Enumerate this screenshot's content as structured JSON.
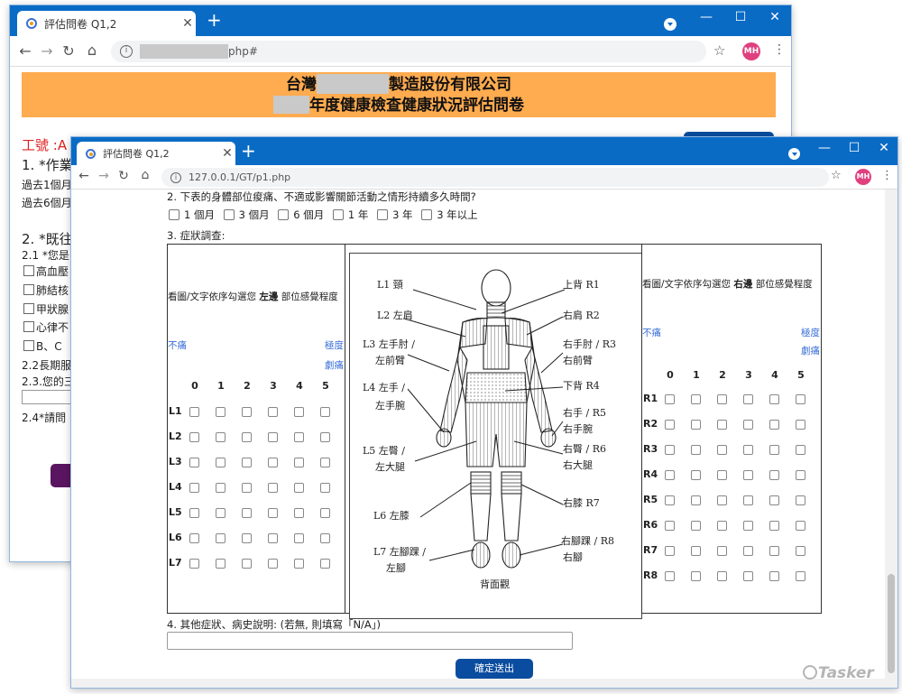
{
  "back_window": {
    "tab_title": "評估問卷 Q1,2",
    "url_suffix": "php#",
    "avatar": "MH",
    "banner_line1_pre": "台灣",
    "banner_line1_post": "製造股份有限公司",
    "banner_line2_post": "年度健康檢查健康狀況評估問卷",
    "employee_label": "工號 :A",
    "q1": "1. *作業",
    "past1": "過去1個月",
    "past6": "過去6個月",
    "q2": "2. *既往",
    "q21": "2.1 *您是",
    "items": [
      "高血壓",
      "肺結核",
      "甲狀腺",
      "心律不",
      "B、C"
    ],
    "q22": "2.2長期服",
    "q23": "2.3.您的三",
    "q24": "2.4*請問"
  },
  "front_window": {
    "tab_title": "評估問卷 Q1,2",
    "url": "127.0.0.1/GT/p1.php",
    "avatar": "MH",
    "q2_text": "2. 下表的身體部位痠痛、不適或影響關節活動之情形持續多久時間?",
    "durations": [
      "1 個月",
      "3 個月",
      "6 個月",
      "1 年",
      "3 年",
      "3 年以上"
    ],
    "q3_text": "3. 症狀調查:",
    "left_panel": {
      "title_pre": "看圖/文字依序勾選您 ",
      "title_bold": "左邊",
      "title_post": " 部位感覺程度",
      "min_label": "不痛",
      "max_label_1": "極度",
      "max_label_2": "劇痛",
      "scale": [
        "0",
        "1",
        "2",
        "3",
        "4",
        "5"
      ],
      "rows": [
        "L1",
        "L2",
        "L3",
        "L4",
        "L5",
        "L6",
        "L7"
      ]
    },
    "right_panel": {
      "title_pre": "看圖/文字依序勾選您 ",
      "title_bold": "右邊",
      "title_post": " 部位感覺程度",
      "min_label": "不痛",
      "max_label_1": "極度",
      "max_label_2": "劇痛",
      "scale": [
        "0",
        "1",
        "2",
        "3",
        "4",
        "5"
      ],
      "rows": [
        "R1",
        "R2",
        "R3",
        "R4",
        "R5",
        "R6",
        "R7",
        "R8"
      ]
    },
    "figure_labels": {
      "l1": "L1 頸",
      "l2": "L2 左肩",
      "l3a": "L3 左手肘 /",
      "l3b": "左前臂",
      "l4a": "L4 左手 /",
      "l4b": "左手腕",
      "l5a": "L5 左臀 /",
      "l5b": "左大腿",
      "l6": "L6 左膝",
      "l7a": "L7 左腳踝 /",
      "l7b": "左腳",
      "r1": "上背 R1",
      "r2": "右肩 R2",
      "r3a": "右手肘 / R3",
      "r3b": "右前臂",
      "r4": "下背 R4",
      "r5a": "右手 / R5",
      "r5b": "右手腕",
      "r6a": "右臀 / R6",
      "r6b": "右大腿",
      "r7": "右膝 R7",
      "r8a": "右腳踝 / R8",
      "r8b": "右腳",
      "caption": "背面觀"
    },
    "q4_text": "4. 其他症狀、病史說明: (若無, 則填寫「N/A」)",
    "submit_label": "確定送出"
  },
  "watermark": "Tasker"
}
